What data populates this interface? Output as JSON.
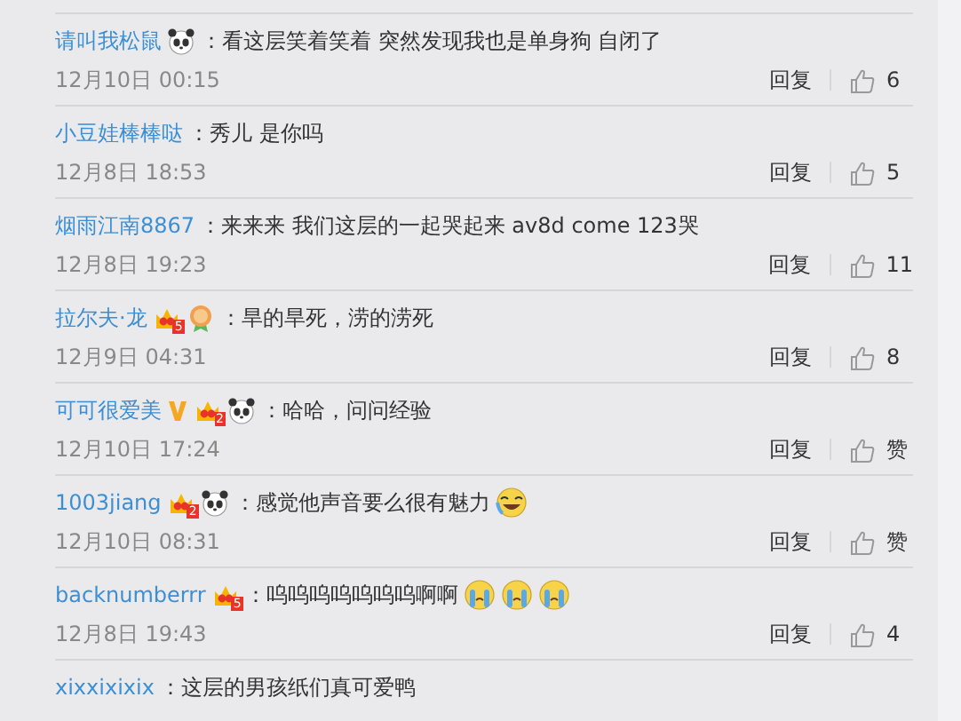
{
  "comments": [
    {
      "user": "请叫我松鼠",
      "badges": [
        {
          "kind": "panda"
        }
      ],
      "text": "：看这层笑着笑着 突然发现我也是单身狗 自闭了",
      "date": "12月10日 00:15",
      "reply": "回复",
      "likes": "6"
    },
    {
      "user": "小豆娃棒棒哒",
      "text": "：秀儿 是你吗",
      "date": "12月8日 18:53",
      "reply": "回复",
      "likes": "5"
    },
    {
      "user": "烟雨江南8867",
      "text": "：来来来 我们这层的一起哭起来 av8d come 123哭",
      "date": "12月8日 19:23",
      "reply": "回复",
      "likes": "11"
    },
    {
      "user": "拉尔夫·龙",
      "badges": [
        {
          "kind": "crown",
          "rank": "5"
        },
        {
          "kind": "medal"
        }
      ],
      "text": "：旱的旱死，涝的涝死",
      "date": "12月9日 04:31",
      "reply": "回复",
      "likes": "8"
    },
    {
      "user": "可可很爱美",
      "badges": [
        {
          "kind": "vip"
        },
        {
          "kind": "crown",
          "rank": "2"
        },
        {
          "kind": "panda"
        }
      ],
      "text": "：哈哈，问问经验",
      "date": "12月10日 17:24",
      "reply": "回复",
      "likes": "赞"
    },
    {
      "user": "1003jiang",
      "badges": [
        {
          "kind": "crown",
          "rank": "2"
        },
        {
          "kind": "panda"
        }
      ],
      "text": "：感觉他声音要么很有魅力",
      "emojis": [
        {
          "kind": "laughing"
        }
      ],
      "date": "12月10日 08:31",
      "reply": "回复",
      "likes": "赞"
    },
    {
      "user": "backnumberrr",
      "badges": [
        {
          "kind": "crown",
          "rank": "5"
        }
      ],
      "text": "：呜呜呜呜呜呜呜啊啊",
      "emojis": [
        {
          "kind": "crying"
        },
        {
          "kind": "crying"
        },
        {
          "kind": "crying"
        }
      ],
      "date": "12月8日 19:43",
      "reply": "回复",
      "likes": "4"
    },
    {
      "user": "xixxixixix",
      "text": "：这层的男孩纸们真可爱鸭"
    }
  ]
}
